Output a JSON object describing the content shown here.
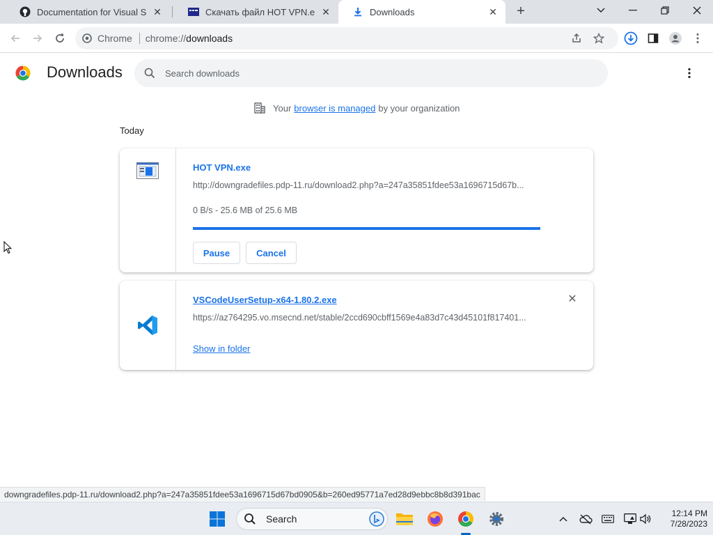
{
  "tabs": [
    {
      "title": "Documentation for Visual Studio"
    },
    {
      "title": "Скачать файл HOT VPN.exe :: Ф..."
    },
    {
      "title": "Downloads"
    }
  ],
  "toolbar": {
    "chip": "Chrome",
    "url_scheme": "chrome://",
    "url_host": "downloads"
  },
  "header": {
    "title": "Downloads",
    "search_placeholder": "Search downloads"
  },
  "managed": {
    "prefix": "Your",
    "link": "browser is managed",
    "suffix": "by your organization"
  },
  "date_label": "Today",
  "downloads": [
    {
      "filename": "HOT VPN.exe",
      "url": "http://downgradefiles.pdp-11.ru/download2.php?a=247a35851fdee53a1696715d67b...",
      "status": "0 B/s - 25.6 MB of 25.6 MB",
      "progress": 1.0,
      "pause_label": "Pause",
      "cancel_label": "Cancel"
    },
    {
      "filename": "VSCodeUserSetup-x64-1.80.2.exe",
      "url": "https://az764295.vo.msecnd.net/stable/2ccd690cbff1569e4a83d7c43d45101f817401...",
      "action_label": "Show in folder"
    }
  ],
  "statusbar": "downgradefiles.pdp-11.ru/download2.php?a=247a35851fdee53a1696715d67bd0905&b=260ed95771a7ed28d9ebbc8b8d391bac",
  "taskbar": {
    "search_label": "Search",
    "time": "12:14 PM",
    "date": "7/28/2023"
  },
  "colors": {
    "accent": "#1a73e8",
    "tabstrip": "#dee1e6",
    "taskbar": "#e9edf2"
  }
}
